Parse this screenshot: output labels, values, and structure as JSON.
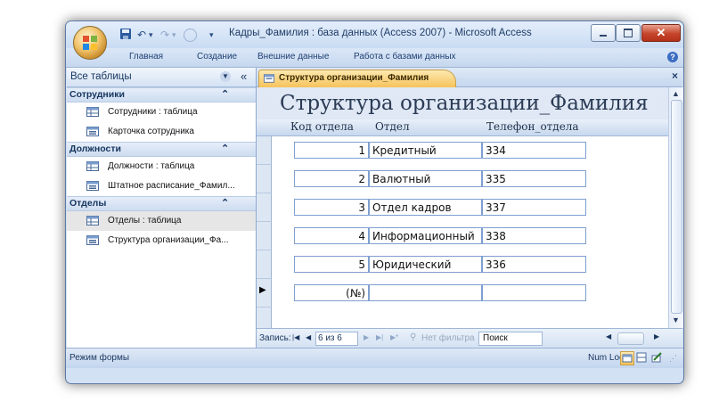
{
  "window": {
    "title": "Кадры_Фамилия : база данных (Access 2007) - Microsoft Access",
    "qat_undo": "↶",
    "qat_redo": "↷",
    "qat_dropdown": "▾"
  },
  "ribbon_tabs": [
    "Главная",
    "Создание",
    "Внешние данные",
    "Работа с базами данных"
  ],
  "nav_pane": {
    "header": "Все таблицы",
    "groups": [
      {
        "name": "Сотрудники",
        "items": [
          {
            "label": "Сотрудники : таблица",
            "icon": "table-icon"
          },
          {
            "label": "Карточка сотрудника",
            "icon": "form-icon"
          }
        ]
      },
      {
        "name": "Должности",
        "items": [
          {
            "label": "Должности : таблица",
            "icon": "table-icon"
          },
          {
            "label": "Штатное расписание_Фамил...",
            "icon": "form-icon"
          }
        ]
      },
      {
        "name": "Отделы",
        "items": [
          {
            "label": "Отделы : таблица",
            "icon": "table-icon",
            "selected": true
          },
          {
            "label": "Структура организации_Фа...",
            "icon": "form-icon"
          }
        ]
      }
    ]
  },
  "document": {
    "tab_label": "Структура организации_Фамилия",
    "form_title": "Структура организации_Фамилия",
    "columns": [
      "Код отдела",
      "Отдел",
      "Телефон_отдела"
    ],
    "rows": [
      {
        "code": "1",
        "dept": "Кредитный",
        "phone": "334"
      },
      {
        "code": "2",
        "dept": "Валютный",
        "phone": "335"
      },
      {
        "code": "3",
        "dept": "Отдел кадров",
        "phone": "337"
      },
      {
        "code": "4",
        "dept": "Информационный",
        "phone": "338"
      },
      {
        "code": "5",
        "dept": "Юридический",
        "phone": "336"
      },
      {
        "code": "(№)",
        "dept": "",
        "phone": ""
      }
    ],
    "current_row_marker": "▶"
  },
  "record_nav": {
    "label": "Запись:",
    "first": "|◀",
    "prev": "◀",
    "position": "6 из 6",
    "next": "▶",
    "last": "▶|",
    "new": "▶*",
    "filter": "Нет фильтра",
    "search": "Поиск"
  },
  "status": {
    "mode": "Режим формы",
    "numlock": "Num Lock"
  },
  "colors": {
    "accent": "#f6c35c",
    "frame": "#d3e1f4",
    "header_text": "#15355e"
  }
}
